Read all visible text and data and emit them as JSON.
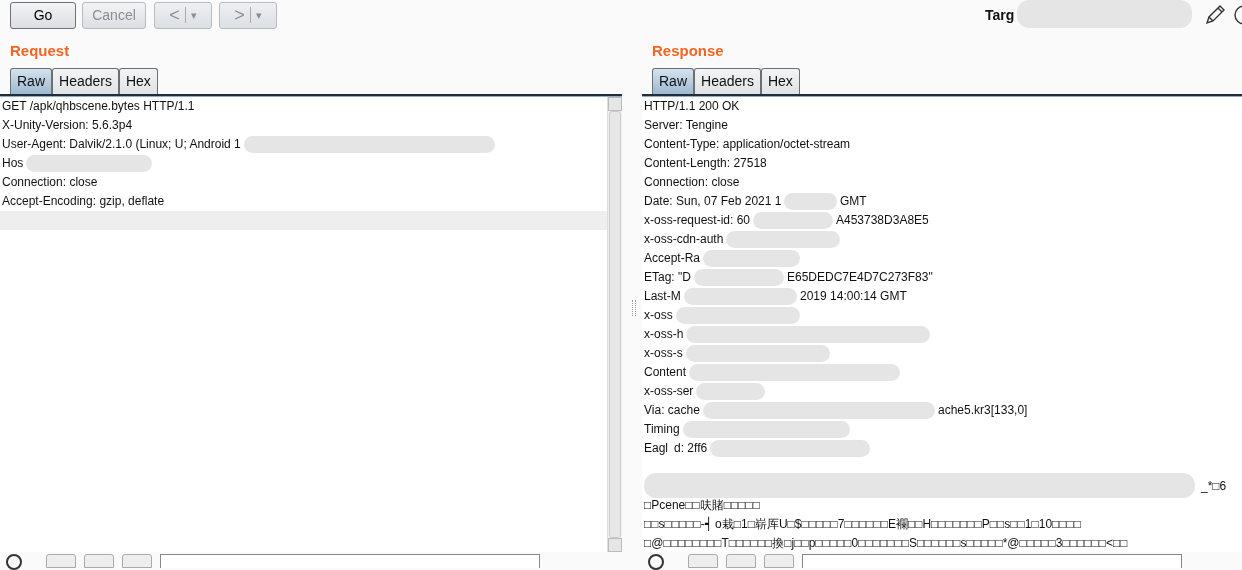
{
  "toolbar": {
    "buttons": [
      {
        "label": "Go",
        "disabled": false
      },
      {
        "label": "Cancel",
        "disabled": true
      }
    ],
    "nav": [
      {
        "glyph": "<",
        "caret": "▾"
      },
      {
        "glyph": ">",
        "caret": "▾"
      }
    ],
    "target_label": "Targ"
  },
  "request": {
    "title": "Request",
    "tabs": [
      {
        "label": "Raw",
        "selected": true
      },
      {
        "label": "Headers",
        "selected": false
      },
      {
        "label": "Hex",
        "selected": false
      }
    ],
    "lines": [
      {
        "parts": [
          "GET /apk/qhbscene.bytes HTTP/1.1"
        ],
        "current": false
      },
      {
        "parts": [
          "X-Unity-Version: 5.6.3p4"
        ],
        "current": false
      },
      {
        "parts": [
          "User-Agent: Dalvik/2.1.0 (Linux; U; Android 1"
        ],
        "current": false
      },
      {
        "parts": [
          "Hos"
        ],
        "current": false
      },
      {
        "parts": [
          "Connection: close"
        ],
        "current": false
      },
      {
        "parts": [
          "Accept-Encoding: gzip, deflate"
        ],
        "current": false
      },
      {
        "current": true
      }
    ]
  },
  "response": {
    "title": "Response",
    "tabs": [
      {
        "label": "Raw",
        "selected": true
      },
      {
        "label": "Headers",
        "selected": false
      },
      {
        "label": "Hex",
        "selected": false
      }
    ],
    "lines": [
      {
        "parts": [
          "HTTP/1.1 200 OK"
        ],
        "current": false
      },
      {
        "parts": [
          "Server: Tengine"
        ],
        "current": false
      },
      {
        "parts": [
          "Content-Type: application/octet-stream"
        ],
        "current": false
      },
      {
        "parts": [
          "Content-Length: 27518"
        ],
        "current": false
      },
      {
        "parts": [
          "Connection: close"
        ],
        "current": false
      },
      {
        "parts": [
          "Date: Sun, 07 Feb 2021 1",
          "GMT"
        ],
        "current": false
      },
      {
        "parts": [
          "x-oss-request-id: 60",
          "A453738D3A8E5"
        ],
        "current": false
      },
      {
        "parts": [
          "x-oss-cdn-auth"
        ],
        "current": false
      },
      {
        "parts": [
          "Accept-Ra"
        ],
        "current": false
      },
      {
        "parts": [
          "ETag: \"D",
          "E65DEDC7E4D7C273F83\""
        ],
        "current": false
      },
      {
        "parts": [
          "Last-M",
          "2019 14:00:14 GMT"
        ],
        "current": false
      },
      {
        "parts": [
          "x-oss"
        ],
        "current": false
      },
      {
        "parts": [
          "x-oss-h"
        ],
        "current": false
      },
      {
        "parts": [
          "x-oss-s"
        ],
        "current": false
      },
      {
        "parts": [
          "Content"
        ],
        "current": false
      },
      {
        "parts": [
          "x-oss-ser"
        ],
        "current": false
      },
      {
        "parts": [
          "Via: cache",
          "ache5.kr3[133,0]"
        ],
        "current": false
      },
      {
        "parts": [
          "Timing"
        ],
        "current": false
      },
      {
        "parts": [
          "Eagl",
          "d: 2ff6"
        ],
        "current": false
      },
      {
        "current": false
      },
      {
        "parts": [
          "_*□6"
        ],
        "current": false
      },
      {
        "parts": [
          "□Pcene□□呋賭□□□□□"
        ],
        "current": false
      },
      {
        "parts": [
          "□□s□□□□□-┥ o栽□1□崭厍U□$□□□□□7□□□□□□E襴□□H□□□□□□□P□□s□□1□10□□□□"
        ],
        "current": false
      },
      {
        "parts": [
          "□@□□□□□□□□T□□□□□□換□j□□p□□□□□0□□□□□□□S□□□□□□s□□□□□*@□□□□□3□□□□□□<□□"
        ],
        "current": false
      }
    ]
  }
}
